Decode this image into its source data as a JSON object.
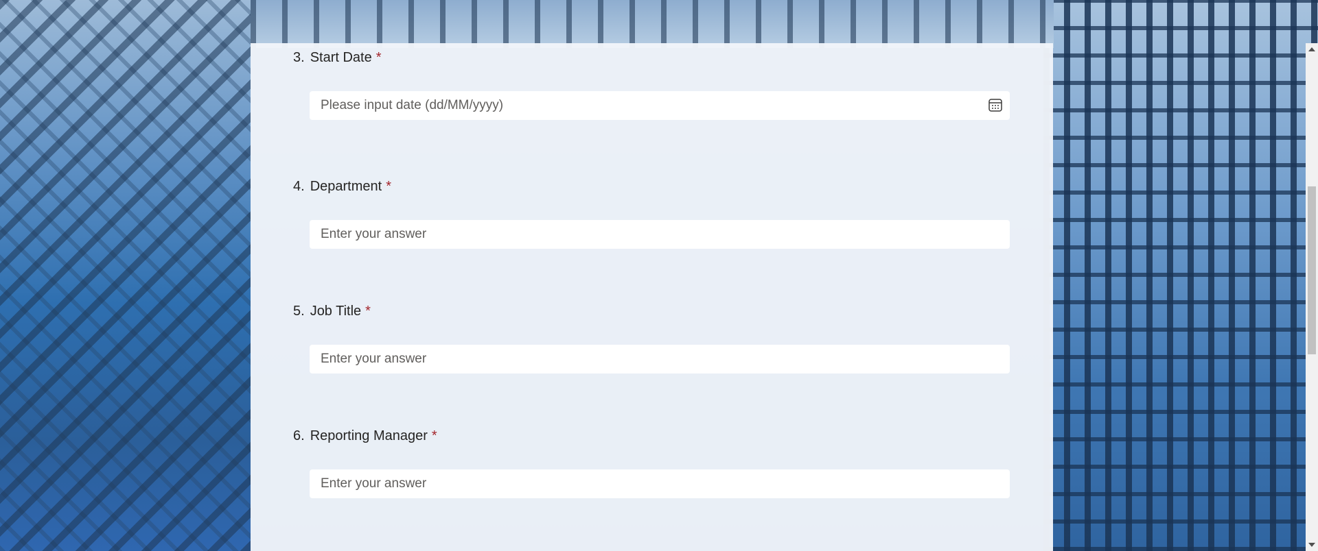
{
  "form": {
    "questions": [
      {
        "number": "3.",
        "label": "Start Date",
        "required_mark": "*",
        "placeholder": "Please input date (dd/MM/yyyy)",
        "value": "",
        "type": "date"
      },
      {
        "number": "4.",
        "label": "Department",
        "required_mark": "*",
        "placeholder": "Enter your answer",
        "value": "",
        "type": "text"
      },
      {
        "number": "5.",
        "label": "Job Title",
        "required_mark": "*",
        "placeholder": "Enter your answer",
        "value": "",
        "type": "text"
      },
      {
        "number": "6.",
        "label": "Reporting Manager",
        "required_mark": "*",
        "placeholder": "Enter your answer",
        "value": "",
        "type": "text"
      }
    ]
  },
  "icons": {
    "date_picker": "calendar-icon"
  },
  "colors": {
    "required": "#a4262c",
    "label_text": "#252423",
    "placeholder_text": "#605e5c",
    "card_background": "#f1f5fa",
    "input_background": "#ffffff"
  }
}
